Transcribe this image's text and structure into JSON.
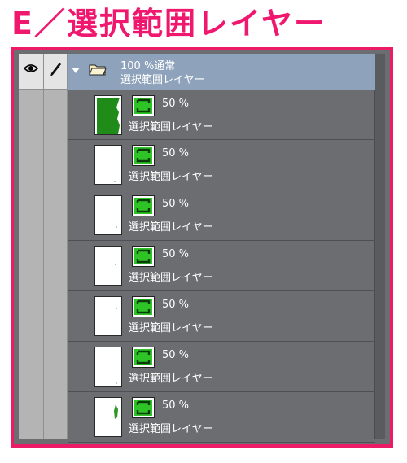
{
  "heading": "E／選択範囲レイヤー",
  "colors": {
    "accent": "#ec1a67",
    "panel": "#6c6d70",
    "folder_highlight": "#8ea3bb",
    "selection_green": "#24a81c"
  },
  "folder": {
    "opacity_blend": "100 %通常",
    "name": "選択範囲レイヤー",
    "icons": [
      "eye-icon",
      "pen-icon",
      "expand-caret-icon",
      "folder-icon"
    ]
  },
  "layers": [
    {
      "opacity": "50 %",
      "name": "選択範囲レイヤー",
      "thumb": "mostly-green"
    },
    {
      "opacity": "50 %",
      "name": "選択範囲レイヤー",
      "thumb": "white"
    },
    {
      "opacity": "50 %",
      "name": "選択範囲レイヤー",
      "thumb": "white"
    },
    {
      "opacity": "50 %",
      "name": "選択範囲レイヤー",
      "thumb": "white"
    },
    {
      "opacity": "50 %",
      "name": "選択範囲レイヤー",
      "thumb": "white"
    },
    {
      "opacity": "50 %",
      "name": "選択範囲レイヤー",
      "thumb": "white"
    },
    {
      "opacity": "50 %",
      "name": "選択範囲レイヤー",
      "thumb": "small-green"
    }
  ]
}
